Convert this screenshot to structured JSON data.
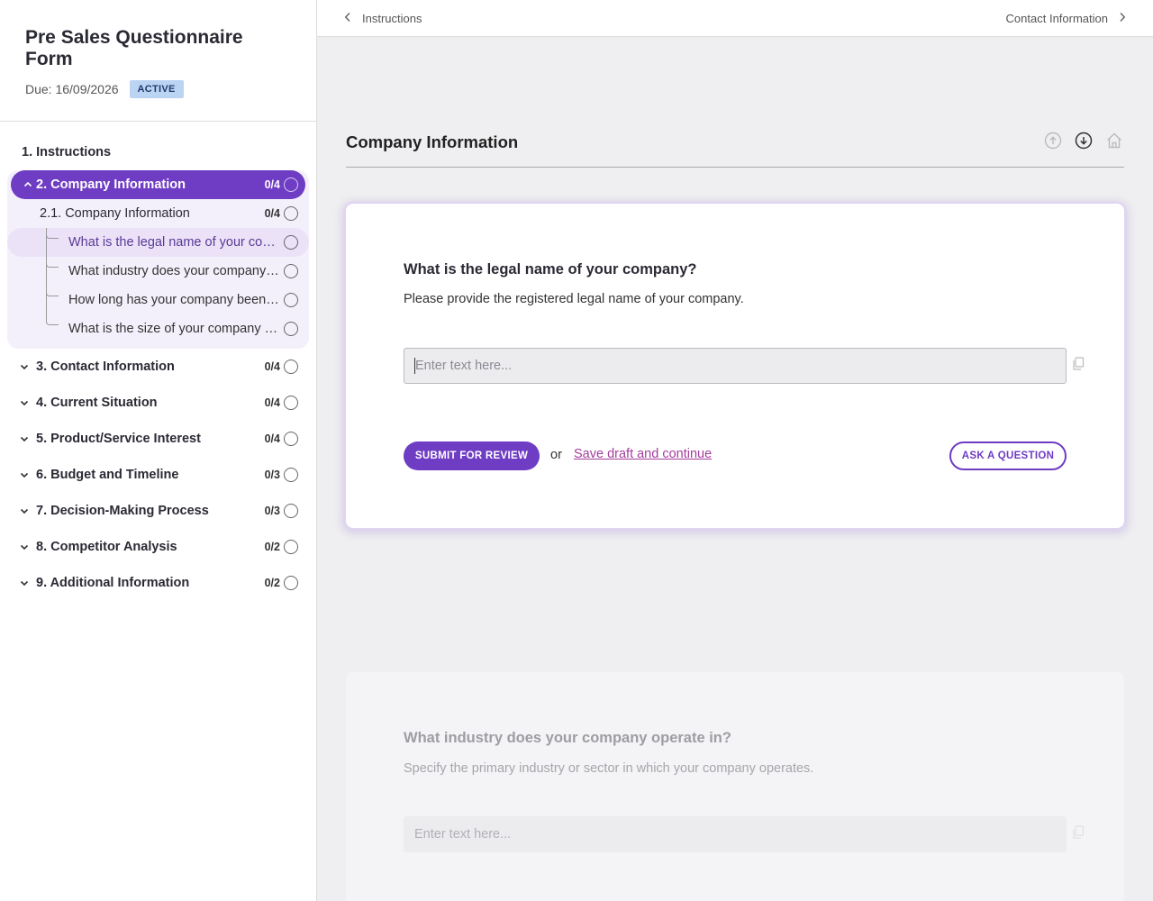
{
  "form": {
    "title": "Pre Sales Questionnaire Form",
    "due": "Due: 16/09/2026",
    "status": "ACTIVE"
  },
  "nav": {
    "instructions": "1. Instructions",
    "active_section": {
      "label": "2. Company Information",
      "count": "0/4"
    },
    "subsection": {
      "label": "2.1. Company Information",
      "count": "0/4"
    },
    "questions": [
      "What is the legal name of your company?",
      "What industry does your company operate in?",
      "How long has your company been in business?",
      "What is the size of your company (employees)?"
    ],
    "sections": [
      {
        "label": "3. Contact Information",
        "count": "0/4"
      },
      {
        "label": "4. Current Situation",
        "count": "0/4"
      },
      {
        "label": "5. Product/Service Interest",
        "count": "0/4"
      },
      {
        "label": "6. Budget and Timeline",
        "count": "0/3"
      },
      {
        "label": "7. Decision-Making Process",
        "count": "0/3"
      },
      {
        "label": "8. Competitor Analysis",
        "count": "0/2"
      },
      {
        "label": "9. Additional Information",
        "count": "0/2"
      }
    ]
  },
  "topbar": {
    "prev": "Instructions",
    "next": "Contact Information"
  },
  "section": {
    "title": "Company Information"
  },
  "question1": {
    "title": "What is the legal name of your company?",
    "description": "Please provide the registered legal name of your company.",
    "placeholder": "Enter text here...",
    "submit": "SUBMIT FOR REVIEW",
    "or": "or",
    "save": "Save draft and continue",
    "ask": "ASK A QUESTION"
  },
  "question2": {
    "title": "What industry does your company operate in?",
    "description": "Specify the primary industry or sector in which your company operates.",
    "placeholder": "Enter text here..."
  },
  "colors": {
    "accent": "#6f3cc4",
    "link": "#a33d9c",
    "badge_bg": "#bcd4f4"
  }
}
